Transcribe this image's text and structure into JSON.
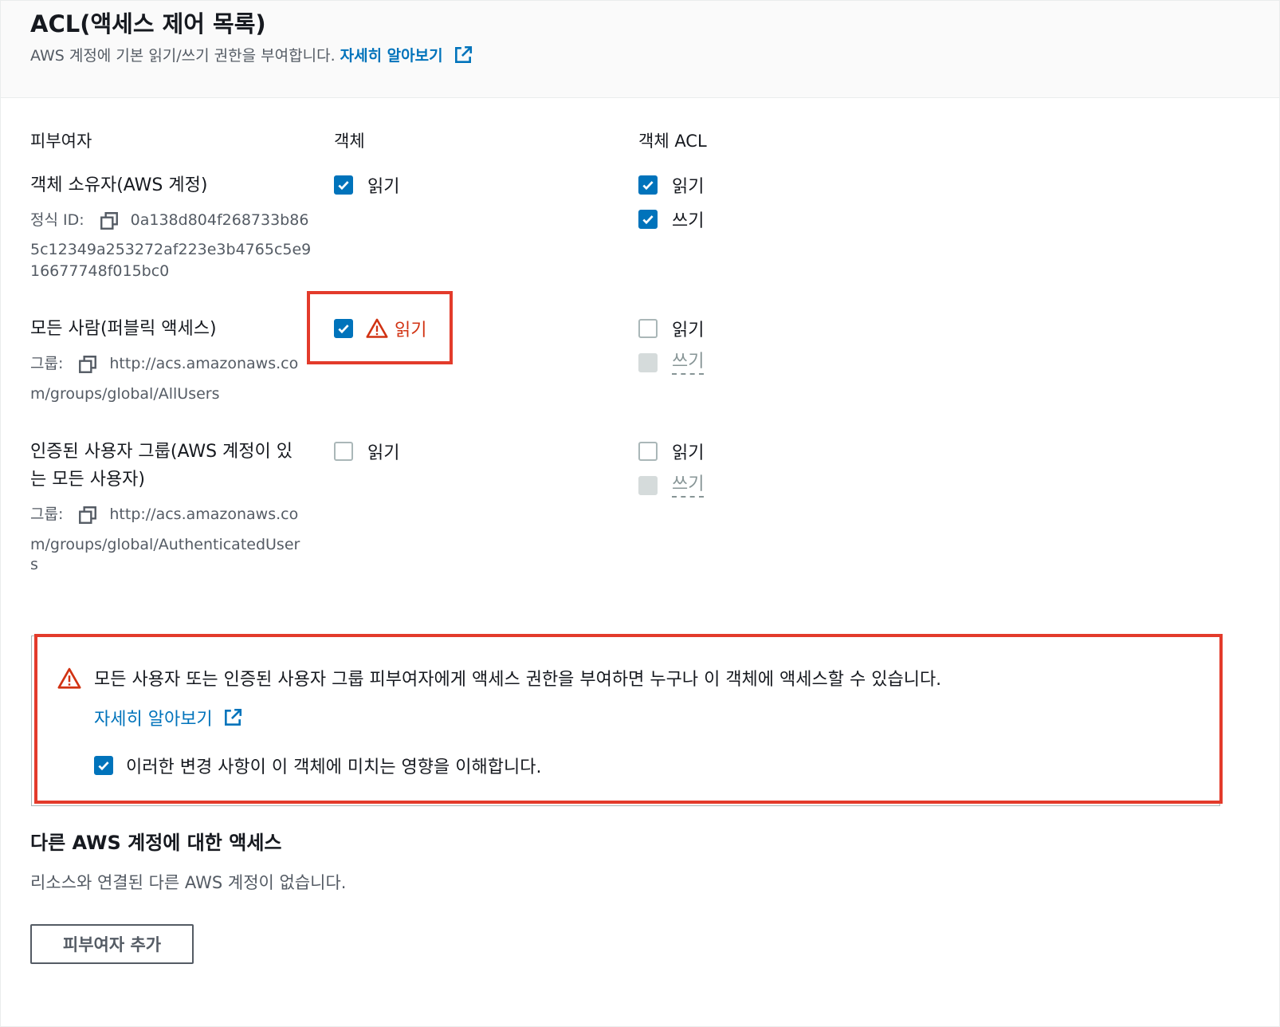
{
  "header": {
    "title": "ACL(액세스 제어 목록)",
    "description": "AWS 계정에 기본 읽기/쓰기 권한을 부여합니다.",
    "learn_more": "자세히 알아보기"
  },
  "columns": {
    "grantee": "피부여자",
    "object": "객체",
    "object_acl": "객체 ACL"
  },
  "grantees": [
    {
      "name": "객체 소유자(AWS 계정)",
      "id_label": "정식 ID:",
      "id_line1": "0a138d804f268733b86",
      "id_line2": "5c12349a253272af223e3b4765c5e9",
      "id_line3": "16677748f015bc0",
      "object_read": {
        "label": "읽기",
        "state": "checked"
      },
      "acl_read": {
        "label": "읽기",
        "state": "checked"
      },
      "acl_write": {
        "label": "쓰기",
        "state": "checked"
      }
    },
    {
      "name": "모든 사람(퍼블릭 액세스)",
      "group_label": "그룹:",
      "group_line1": "http://acs.amazonaws.co",
      "group_line2": "m/groups/global/AllUsers",
      "object_read": {
        "label": "읽기",
        "state": "checked",
        "warning": true
      },
      "acl_read": {
        "label": "읽기",
        "state": "unchecked"
      },
      "acl_write": {
        "label": "쓰기",
        "state": "disabled"
      }
    },
    {
      "name_line1": "인증된 사용자 그룹(AWS 계정이 있",
      "name_line2": "는 모든 사용자)",
      "group_label": "그룹:",
      "group_line1": "http://acs.amazonaws.co",
      "group_line2": "m/groups/global/AuthenticatedUser",
      "group_line3": "s",
      "object_read": {
        "label": "읽기",
        "state": "unchecked"
      },
      "acl_read": {
        "label": "읽기",
        "state": "unchecked"
      },
      "acl_write": {
        "label": "쓰기",
        "state": "disabled"
      }
    }
  ],
  "alert": {
    "message": "모든 사용자 또는 인증된 사용자 그룹 피부여자에게 액세스 권한을 부여하면 누구나 이 객체에 액세스할 수 있습니다.",
    "learn_more": "자세히 알아보기",
    "acknowledge": "이러한 변경 사항이 이 객체에 미치는 영향을 이해합니다.",
    "acknowledge_state": "checked"
  },
  "other_accounts": {
    "title": "다른 AWS 계정에 대한 액세스",
    "empty_text": "리소스와 연결된 다른 AWS 계정이 없습니다.",
    "add_button": "피부여자 추가"
  },
  "colors": {
    "link": "#0073bb",
    "checkbox": "#0073bb",
    "warning": "#d13212",
    "highlight_box": "#e33b2b"
  }
}
